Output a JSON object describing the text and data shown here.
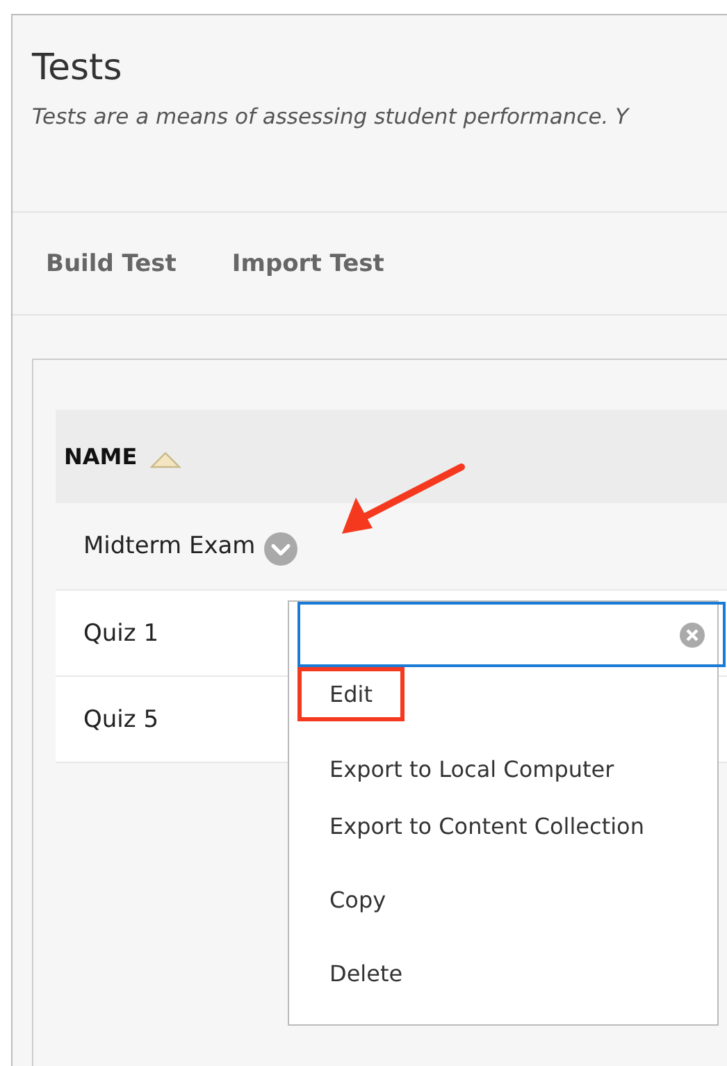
{
  "page": {
    "title": "Tests",
    "description": "Tests are a means of assessing student performance. Y"
  },
  "toolbar": [
    "Build Test",
    "Import Test"
  ],
  "table": {
    "columns": [
      {
        "label": "NAME",
        "sort_ascending": true
      }
    ],
    "rows": [
      {
        "name": "Midterm Exam",
        "selected": true
      },
      {
        "name": "Quiz 1",
        "selected": false
      },
      {
        "name": "Quiz 5",
        "selected": false
      }
    ]
  },
  "context_menu": {
    "items": [
      {
        "label": "Edit",
        "highlighted": true
      },
      {
        "label": "Export to Local Computer",
        "highlighted": false
      },
      {
        "label": "Export to Content Collection",
        "highlighted": false
      },
      {
        "label": "Copy",
        "highlighted": false
      },
      {
        "label": "Delete",
        "highlighted": false
      }
    ]
  }
}
